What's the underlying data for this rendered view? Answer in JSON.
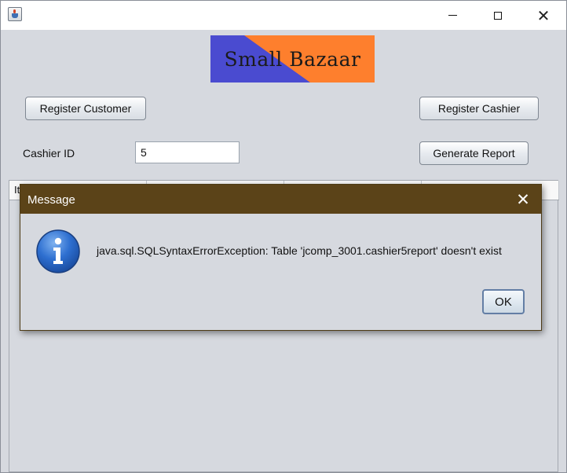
{
  "window": {
    "title": "",
    "controls": {
      "minimize": "minimize-icon",
      "maximize": "maximize-icon",
      "close": "close-icon"
    }
  },
  "logo": {
    "text": "Small Bazaar",
    "colors": {
      "left": "#4a4bd0",
      "right": "#fe7f2d"
    }
  },
  "buttons": {
    "register_customer": "Register Customer",
    "register_cashier": "Register Cashier",
    "generate_report": "Generate Report"
  },
  "cashier": {
    "label": "Cashier ID",
    "value": "5"
  },
  "table": {
    "columns": [
      "It",
      "",
      "",
      ""
    ]
  },
  "dialog": {
    "title": "Message",
    "message": "java.sql.SQLSyntaxErrorException: Table 'jcomp_3001.cashier5report' doesn't exist",
    "ok_label": "OK",
    "title_bar_color": "#5b4318",
    "icon": "info-icon"
  }
}
